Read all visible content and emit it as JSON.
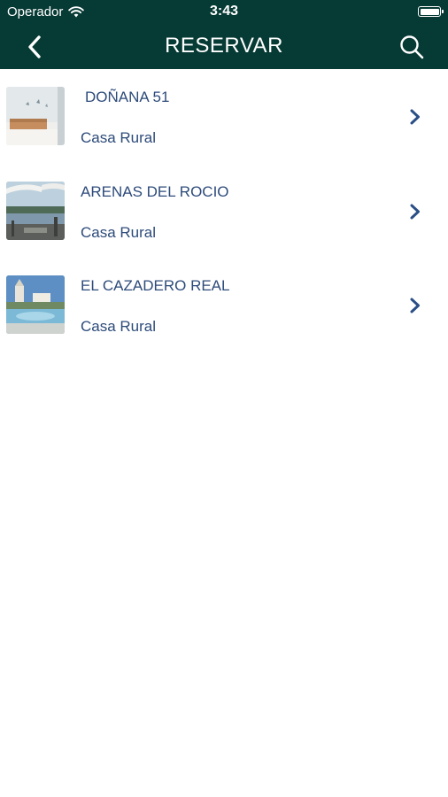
{
  "status_bar": {
    "carrier": "Operador",
    "time": "3:43",
    "battery_level": 1.0
  },
  "nav": {
    "title": "RESERVAR",
    "back_icon": "chevron-left-icon",
    "search_icon": "search-icon"
  },
  "colors": {
    "header_bg": "#063a34",
    "text_blue": "#2d4b7a",
    "chevron_blue": "#2a4f86"
  },
  "items": [
    {
      "title": "DOÑANA 51",
      "subtitle": "Casa Rural",
      "thumbnail": "bedroom-photo"
    },
    {
      "title": "ARENAS DEL ROCIO",
      "subtitle": "Casa Rural",
      "thumbnail": "marsh-terrace-photo"
    },
    {
      "title": "EL CAZADERO REAL",
      "subtitle": "Casa Rural",
      "thumbnail": "pool-church-photo"
    }
  ]
}
